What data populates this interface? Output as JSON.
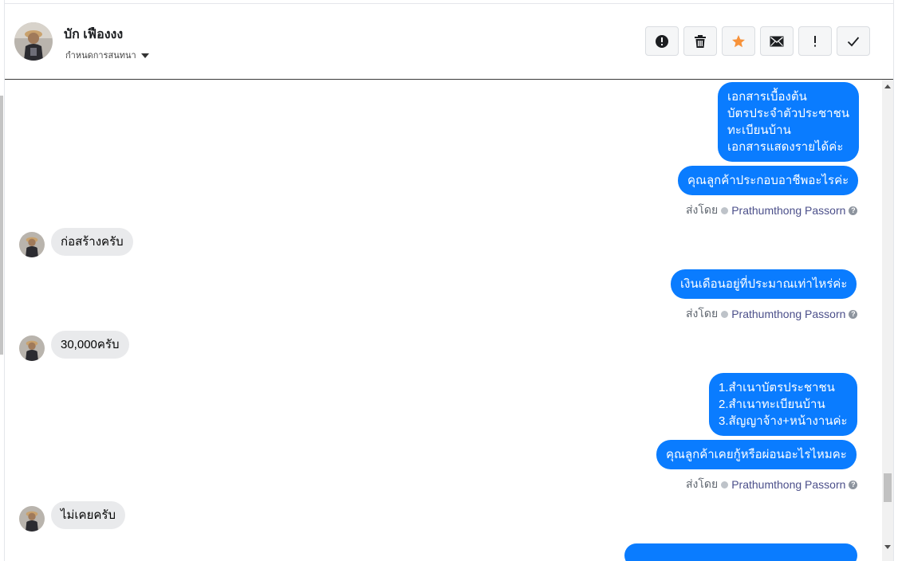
{
  "colors": {
    "accent_blue": "#0a7cff",
    "incoming_bubble": "#e9eaec",
    "star_orange": "#f7923a",
    "sender_name": "#4b4f8a"
  },
  "contact": {
    "name": "บัก เฟืองงง",
    "label_dropdown": "กำหนดการสนทนา"
  },
  "toolbar": [
    {
      "name": "spam-button",
      "icon": "alert-circle-icon"
    },
    {
      "name": "delete-button",
      "icon": "trash-icon"
    },
    {
      "name": "star-button",
      "icon": "star-icon"
    },
    {
      "name": "mark-unread-button",
      "icon": "envelope-icon"
    },
    {
      "name": "follow-up-button",
      "icon": "exclamation-icon"
    },
    {
      "name": "done-button",
      "icon": "checkmark-icon"
    }
  ],
  "messages": {
    "m1": {
      "lines": [
        "เอกสารเบื้องต้น",
        "บัตรประจำตัวประชาชน",
        "ทะเบียนบ้าน",
        "เอกสารแสดงรายได้ค่ะ"
      ]
    },
    "m2": "คุณลูกค้าประกอบอาชีพอะไรค่ะ",
    "sent1": {
      "prefix": "ส่งโดย",
      "who": "Prathumthong Passorn"
    },
    "r1": "ก่อสร้างครับ",
    "m3": "เงินเดือนอยู่ที่ประมาณเท่าไหร่ค่ะ",
    "sent2": {
      "prefix": "ส่งโดย",
      "who": "Prathumthong Passorn"
    },
    "r2": "30,000ครับ",
    "m4": {
      "lines": [
        "1.สำเนาบัตรประชาชน",
        "2.สำเนาทะเบียนบ้าน",
        "3.สัญญาจ้าง+หน้างานค่ะ"
      ]
    },
    "m5": "คุณลูกค้าเคยกู้หรือผ่อนอะไรไหมคะ",
    "sent3": {
      "prefix": "ส่งโดย",
      "who": "Prathumthong Passorn"
    },
    "r3": "ไม่เคยครับ"
  }
}
